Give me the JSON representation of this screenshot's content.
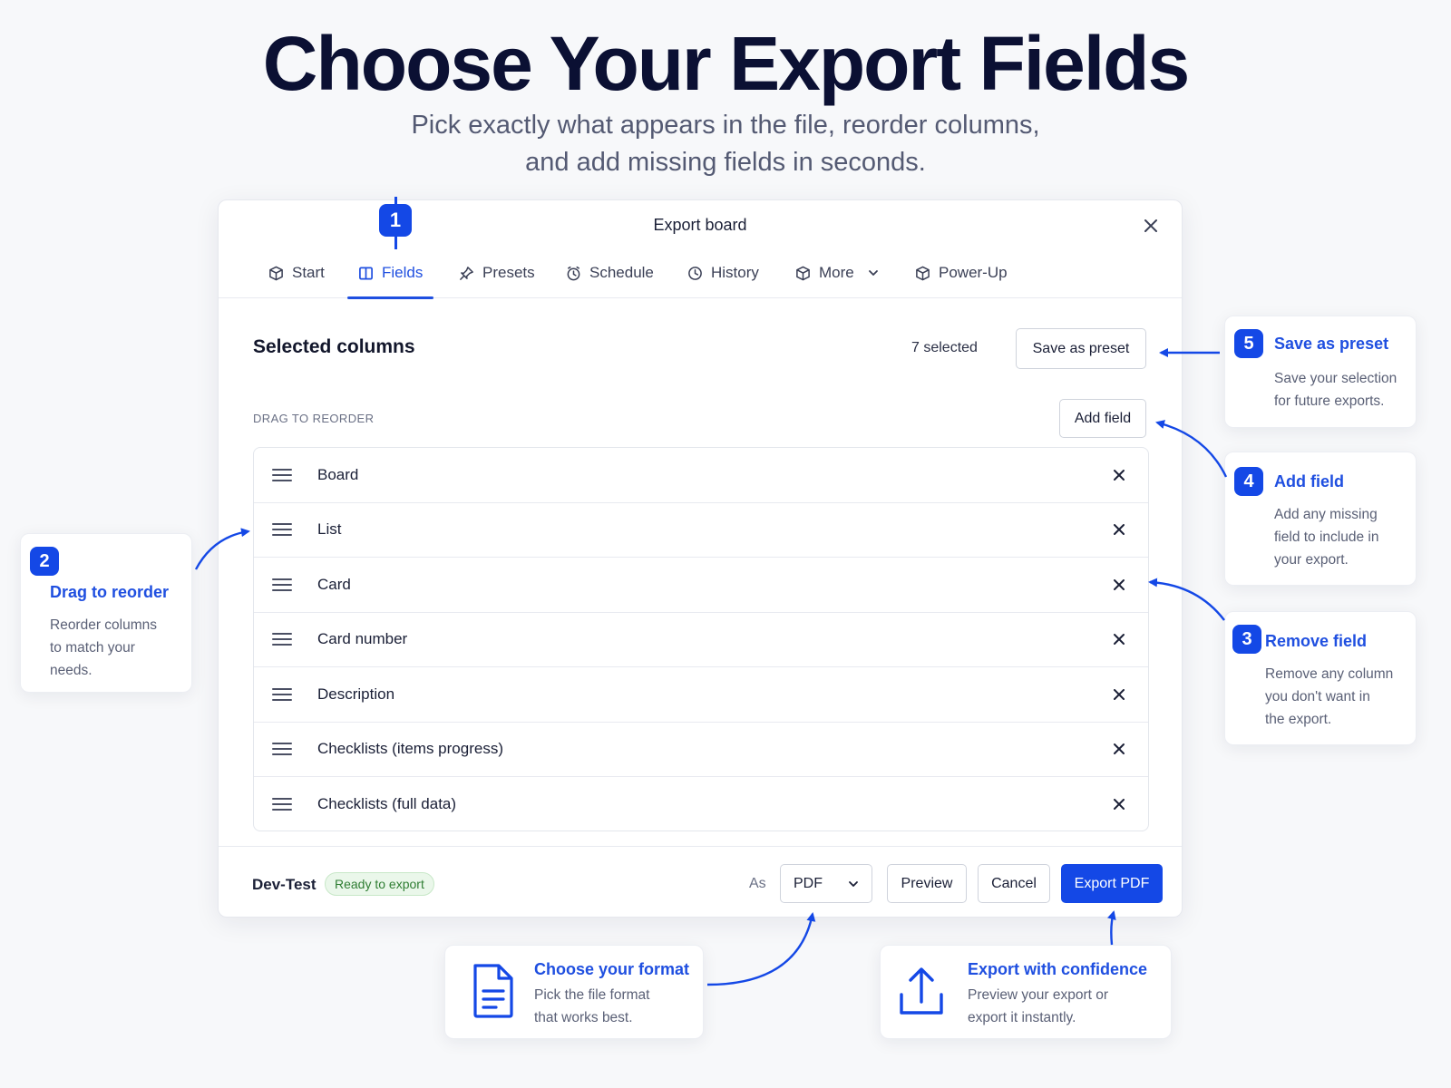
{
  "hero": {
    "title": "Choose Your Export Fields",
    "subtitle_line1": "Pick exactly what appears in the file, reorder columns,",
    "subtitle_line2": "and add missing fields in seconds."
  },
  "dialog": {
    "title": "Export board",
    "tabs": [
      {
        "label": "Start",
        "icon": "cube-icon"
      },
      {
        "label": "Fields",
        "icon": "columns-icon",
        "active": true
      },
      {
        "label": "Presets",
        "icon": "pin-icon"
      },
      {
        "label": "Schedule",
        "icon": "clock-icon"
      },
      {
        "label": "History",
        "icon": "history-icon"
      },
      {
        "label": "More",
        "icon": "cube-icon"
      },
      {
        "label": "Power-Up",
        "icon": "cube-icon"
      }
    ],
    "section_title": "Selected columns",
    "selected_count": "7 selected",
    "save_preset_label": "Save as preset",
    "hint": "DRAG TO REORDER",
    "add_field_label": "Add field",
    "columns": [
      "Board",
      "List",
      "Card",
      "Card number",
      "Description",
      "Checklists (items progress)",
      "Checklists (full data)"
    ],
    "footer": {
      "board_name": "Dev-Test",
      "status": "Ready to export",
      "as_label": "As",
      "format": "PDF",
      "preview_label": "Preview",
      "cancel_label": "Cancel",
      "export_label": "Export PDF"
    }
  },
  "callouts": {
    "step1": {
      "number": "1"
    },
    "step2": {
      "number": "2",
      "title": "Drag to reorder",
      "body_lines": [
        "Reorder columns",
        "to match your",
        "needs."
      ]
    },
    "step3": {
      "number": "3",
      "title": "Remove field",
      "body_lines": [
        "Remove any column",
        "you don't want in",
        "the export."
      ]
    },
    "step4": {
      "number": "4",
      "title": "Add field",
      "body_lines": [
        "Add any missing",
        "field to include in",
        "your export."
      ]
    },
    "step5": {
      "number": "5",
      "title": "Save as preset",
      "body_lines": [
        "Save your selection",
        "for future exports."
      ]
    },
    "format": {
      "title": "Choose your format",
      "body_lines": [
        "Pick the file format",
        "that works best."
      ],
      "icon": "document-icon"
    },
    "export": {
      "title": "Export with confidence",
      "body_lines": [
        "Preview your export or",
        "export it instantly."
      ],
      "icon": "upload-icon"
    }
  },
  "colors": {
    "accent": "#1448e6",
    "accent_text": "#1f4fe0",
    "success_bg": "#eaf7ea",
    "success_text": "#2e7d32"
  }
}
